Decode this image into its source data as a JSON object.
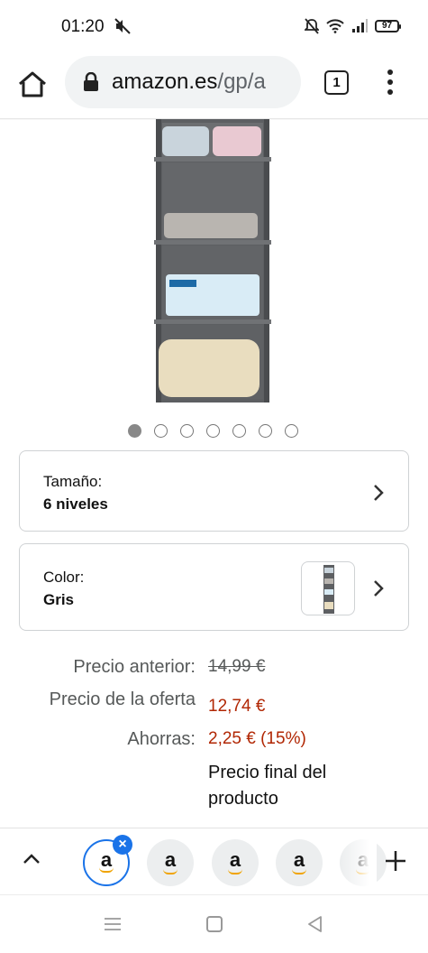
{
  "status_bar": {
    "time": "01:20",
    "battery": "97",
    "icons": [
      "mute-icon",
      "alarm-off-icon",
      "wifi-icon",
      "signal-icon",
      "battery-icon"
    ]
  },
  "browser": {
    "url_host": "amazon.es",
    "url_path": "/gp/a",
    "tab_count": "1",
    "icons": [
      "home-icon",
      "lock-icon",
      "menu-dots-icon"
    ]
  },
  "gallery": {
    "image_count": 7,
    "active_index": 0
  },
  "options": {
    "size": {
      "label": "Tamaño:",
      "value": "6 niveles"
    },
    "color": {
      "label": "Color:",
      "value": "Gris"
    }
  },
  "price": {
    "old_label": "Precio anterior:",
    "old_value": "14,99 €",
    "offer_label": "Precio de la oferta",
    "offer_value": "12,74 €",
    "save_label": "Ahorras:",
    "save_value": "2,25 € (15%)",
    "final_note": "Precio final del producto"
  },
  "tab_strip": {
    "tabs": [
      {
        "letter": "a",
        "selected": true
      },
      {
        "letter": "a",
        "selected": false
      },
      {
        "letter": "a",
        "selected": false
      },
      {
        "letter": "a",
        "selected": false
      },
      {
        "letter": "a",
        "selected": false
      }
    ],
    "close_glyph": "×"
  },
  "colors": {
    "price_red": "#b12704",
    "accent_blue": "#1a73e8",
    "amazon_orange": "#f0a300",
    "muted_text": "#565959"
  }
}
